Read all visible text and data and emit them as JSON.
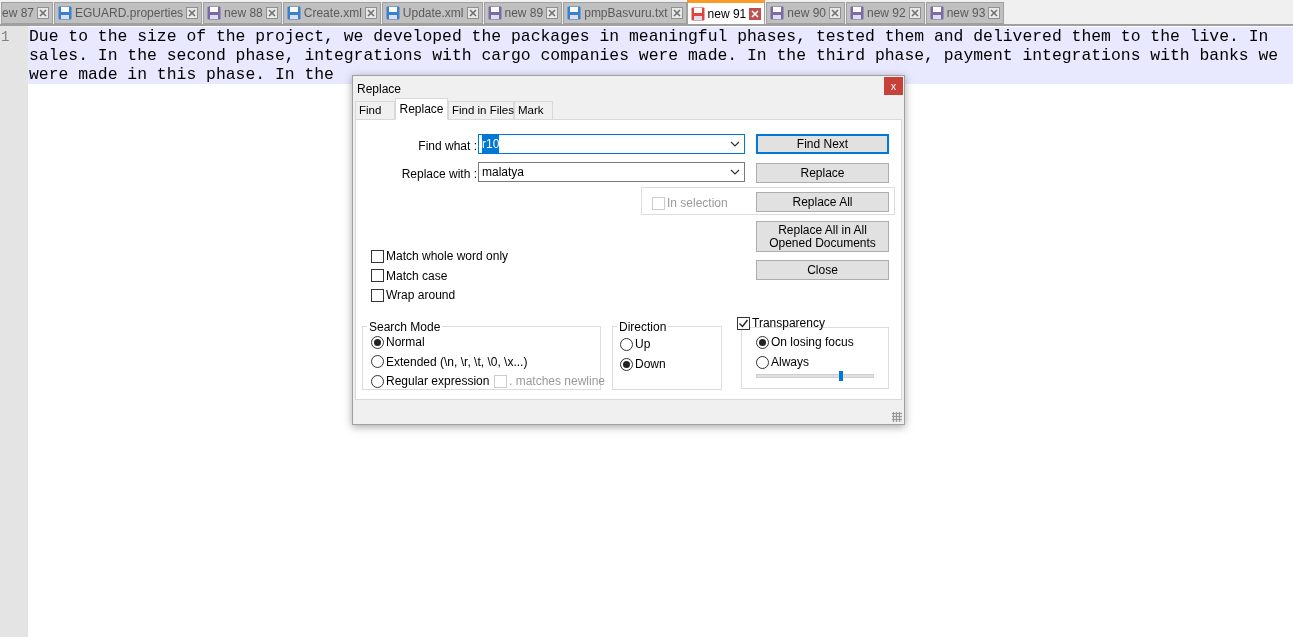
{
  "tabs": [
    {
      "label": "ew 87",
      "selected": false
    },
    {
      "label": "EGUARD.properties",
      "color": "#3a7fd0",
      "selected": false
    },
    {
      "label": "new 88",
      "color": "#7a6aa8",
      "selected": false
    },
    {
      "label": "Create.xml",
      "color": "#3a7fd0",
      "selected": false
    },
    {
      "label": "Update.xml",
      "color": "#3a7fd0",
      "selected": false
    },
    {
      "label": "new 89",
      "color": "#7a6aa8",
      "selected": false
    },
    {
      "label": "pmpBasvuru.txt",
      "color": "#3a7fd0",
      "selected": false
    },
    {
      "label": "new 91",
      "color": "#e0453d",
      "selected": true
    },
    {
      "label": "new 90",
      "color": "#7a6aa8",
      "selected": false
    },
    {
      "label": "new 92",
      "color": "#7a6aa8",
      "selected": false
    },
    {
      "label": "new 93",
      "color": "#7a6aa8",
      "selected": false
    }
  ],
  "editor": {
    "line_numbers": [
      "1"
    ],
    "selected": true,
    "lines": [
      "Due to the size of the project, we developed the packages in meaningful phases, tested them and delivered them to the live. In",
      "sales. In the second phase, integrations with cargo companies were made. In the third phase, payment integrations with banks we",
      "were made in this phase. In the"
    ]
  },
  "dialog": {
    "title": "Replace",
    "close": "x",
    "tabs": [
      {
        "label": "Find",
        "selected": false
      },
      {
        "label": "Replace",
        "selected": true
      },
      {
        "label": "Find in Files",
        "selected": false
      },
      {
        "label": "Mark",
        "selected": false
      }
    ],
    "find_what": {
      "label": "Find what :",
      "value": "r10",
      "value_selected": true
    },
    "replace_with": {
      "label": "Replace with :",
      "value": "malatya",
      "value_selected": false
    },
    "in_selection": {
      "label": "In selection",
      "checked": false,
      "disabled": true
    },
    "buttons": [
      {
        "label": "Find Next",
        "default": true
      },
      {
        "label": "Replace",
        "default": false
      },
      {
        "label": "Replace All",
        "default": false
      },
      {
        "label": "Replace All in All Opened Documents",
        "default": false
      },
      {
        "label": "Close",
        "default": false
      }
    ],
    "checkboxes": [
      {
        "label": "Match whole word only",
        "checked": false
      },
      {
        "label": "Match case",
        "checked": false
      },
      {
        "label": "Wrap around",
        "checked": false
      }
    ],
    "search_mode": {
      "title": "Search Mode",
      "options": [
        {
          "label": "Normal",
          "selected": true
        },
        {
          "label": "Extended (\\n, \\r, \\t, \\0, \\x...)",
          "selected": false
        },
        {
          "label": "Regular expression",
          "selected": false
        }
      ],
      "matches_newline": {
        "label": ". matches newline",
        "checked": false,
        "disabled": true
      }
    },
    "direction": {
      "title": "Direction",
      "options": [
        {
          "label": "Up",
          "selected": false
        },
        {
          "label": "Down",
          "selected": true
        }
      ]
    },
    "transparency": {
      "label": "Transparency",
      "checked": true,
      "options": [
        {
          "label": "On losing focus",
          "selected": true
        },
        {
          "label": "Always",
          "selected": false
        }
      ],
      "slider": {
        "level": 0.72
      }
    }
  }
}
